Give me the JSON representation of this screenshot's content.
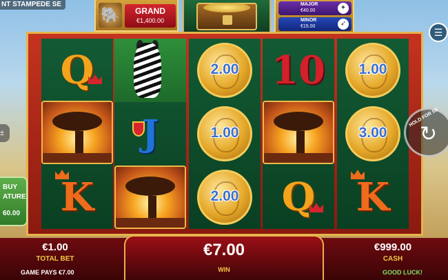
{
  "game": {
    "title": "NT STAMPEDE SE"
  },
  "jackpots": {
    "grand": {
      "label": "GRAND",
      "value": "€1,400.00",
      "icon": "elephant-icon"
    },
    "major": {
      "label": "MAJOR",
      "value": "€40.00",
      "icon": "gazelle-icon"
    },
    "minor": {
      "label": "MINOR",
      "value": "€15.00",
      "icon": "bird-icon"
    }
  },
  "reels": {
    "reel1": [
      "Q",
      "tree",
      "K"
    ],
    "reel2": [
      "zebra",
      "J",
      "tree"
    ],
    "reel3": [
      "2.00",
      "1.00",
      "2.00"
    ],
    "reel4": [
      "10",
      "tree",
      "Q"
    ],
    "reel5": [
      "1.00",
      "3.00",
      "K"
    ]
  },
  "controls": {
    "spin_hint": "HOLD FOR SE",
    "buy_feature": {
      "line1": "BUY",
      "line2": "ATURE",
      "line3": "60.00"
    },
    "bet_adjust": "±",
    "menu_icon": "menu-icon"
  },
  "status": {
    "total_bet_value": "€1.00",
    "total_bet_label": "TOTAL BET",
    "win_value": "€7.00",
    "win_label": "WIN",
    "cash_value": "€999.00",
    "cash_label": "CASH",
    "game_pays": "GAME PAYS €7.00",
    "good_luck": "GOOD LUCK!"
  },
  "colors": {
    "accent_gold": "#e6b44c",
    "bar_red": "#6e0b10",
    "reel_green": "#135b34"
  }
}
